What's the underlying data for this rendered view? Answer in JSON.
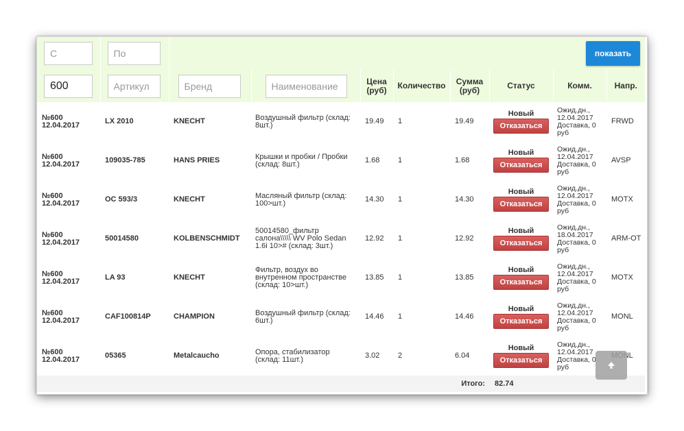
{
  "filters": {
    "from_placeholder": "С",
    "to_placeholder": "По",
    "show_label": "показать",
    "order_value": "600",
    "article_placeholder": "Артикул",
    "brand_placeholder": "Бренд",
    "name_placeholder": "Наименование"
  },
  "columns": {
    "price": "Цена (руб)",
    "qty": "Количество",
    "sum": "Сумма (руб)",
    "status": "Статус",
    "comment": "Комм.",
    "direction": "Напр."
  },
  "rows": [
    {
      "order": "№600",
      "date": "12.04.2017",
      "article": "LX 2010",
      "brand": "KNECHT",
      "name": "Воздушный фильтр (склад: 8шт.)",
      "price": "19.49",
      "qty": "1",
      "sum": "19.49",
      "status": "Новый",
      "action": "Отказаться",
      "comment": "Ожид.дн., 12.04.2017 Доставка, 0 руб",
      "direction": "FRWD"
    },
    {
      "order": "№600",
      "date": "12.04.2017",
      "article": "109035-785",
      "brand": "HANS PRIES",
      "name": "Крышки и пробки / Пробки (склад: 8шт.)",
      "price": "1.68",
      "qty": "1",
      "sum": "1.68",
      "status": "Новый",
      "action": "Отказаться",
      "comment": "Ожид.дн., 12.04.2017 Доставка, 0 руб",
      "direction": "AVSP"
    },
    {
      "order": "№600",
      "date": "12.04.2017",
      "article": "OC 593/3",
      "brand": "KNECHT",
      "name": "Масляный фильтр (склад: 100>шт.)",
      "price": "14.30",
      "qty": "1",
      "sum": "14.30",
      "status": "Новый",
      "action": "Отказаться",
      "comment": "Ожид.дн., 12.04.2017 Доставка, 0 руб",
      "direction": "MOTX"
    },
    {
      "order": "№600",
      "date": "12.04.2017",
      "article": "50014580",
      "brand": "KOLBENSCHMIDT",
      "name": "50014580_фильтр салона\\\\\\\\\\ WV Polo Sedan 1.6i 10>#  (склад: 3шт.)",
      "price": "12.92",
      "qty": "1",
      "sum": "12.92",
      "status": "Новый",
      "action": "Отказаться",
      "comment": "Ожид.дн., 18.04.2017 Доставка, 0 руб",
      "direction": "ARM-OT"
    },
    {
      "order": "№600",
      "date": "12.04.2017",
      "article": "LA 93",
      "brand": "KNECHT",
      "name": "Фильтр, воздух во внутренном пространстве (склад: 10>шт.)",
      "price": "13.85",
      "qty": "1",
      "sum": "13.85",
      "status": "Новый",
      "action": "Отказаться",
      "comment": "Ожид.дн., 12.04.2017 Доставка, 0 руб",
      "direction": "MOTX"
    },
    {
      "order": "№600",
      "date": "12.04.2017",
      "article": "CAF100814P",
      "brand": "CHAMPION",
      "name": "Воздушный фильтр (склад: 6шт.)",
      "price": "14.46",
      "qty": "1",
      "sum": "14.46",
      "status": "Новый",
      "action": "Отказаться",
      "comment": "Ожид.дн., 12.04.2017 Доставка, 0 руб",
      "direction": "MONL"
    },
    {
      "order": "№600",
      "date": "12.04.2017",
      "article": "05365",
      "brand": "Metalcaucho",
      "name": "Опора, стабилизатор (склад: 11шт.)",
      "price": "3.02",
      "qty": "2",
      "sum": "6.04",
      "status": "Новый",
      "action": "Отказаться",
      "comment": "Ожид.дн., 12.04.2017 Доставка, 0 руб",
      "direction": "MONL"
    }
  ],
  "total": {
    "label": "Итого:",
    "value": "82.74"
  },
  "scroll_top_icon": "arrow-up-icon"
}
